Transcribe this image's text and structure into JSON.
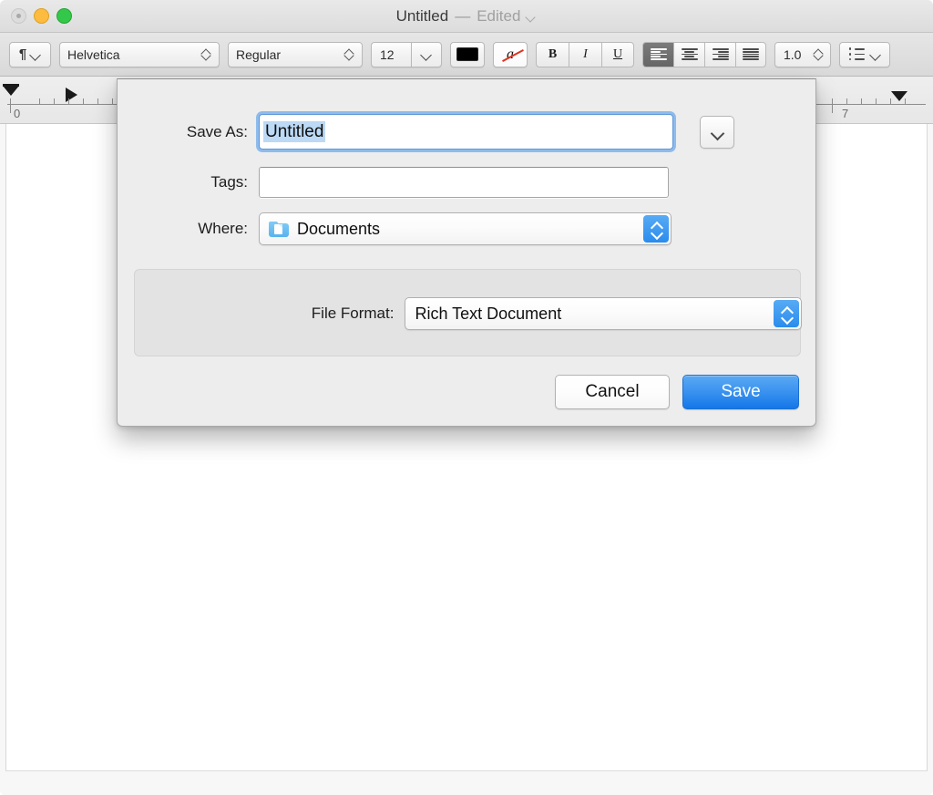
{
  "window": {
    "title_name": "Untitled",
    "title_separator": "—",
    "title_state": "Edited",
    "traffic_lights": [
      "close-button",
      "minimize-button",
      "zoom-button"
    ]
  },
  "toolbar": {
    "paragraph_style_icon": "pilcrow-icon",
    "font_family": "Helvetica",
    "font_style": "Regular",
    "font_size": "12",
    "text_color": "#000000",
    "highlight_label": "a",
    "bold_label": "B",
    "italic_label": "I",
    "underline_label": "U",
    "alignments": [
      "align-left",
      "align-center",
      "align-right",
      "align-justify"
    ],
    "alignment_selected": "align-left",
    "line_spacing": "1.0",
    "list_icon": "bullet-list-icon"
  },
  "ruler": {
    "left_number": "0",
    "right_number": "7",
    "left_indent_marker": "left-indent-marker",
    "right_indent_marker": "right-indent-marker",
    "tab_stop": "tab-stop-marker"
  },
  "sheet": {
    "save_as": {
      "label": "Save As:",
      "value": "Untitled",
      "selected": true,
      "expand_icon": "chevron-down-icon"
    },
    "tags": {
      "label": "Tags:",
      "value": "",
      "placeholder": ""
    },
    "where": {
      "label": "Where:",
      "value": "Documents",
      "icon": "documents-folder-icon",
      "stepper_icon": "up-down-chevrons-icon"
    },
    "file_format": {
      "label": "File Format:",
      "value": "Rich Text Document",
      "stepper_icon": "up-down-chevrons-icon"
    },
    "buttons": {
      "cancel": "Cancel",
      "save": "Save"
    }
  },
  "colors": {
    "accent_blue": "#1476e8",
    "focus_ring": "#6eaaeb",
    "selection": "#bcd9f5",
    "folder_blue": "#56b3ee",
    "minimize": "#fdbc40",
    "zoom": "#34c84a"
  }
}
